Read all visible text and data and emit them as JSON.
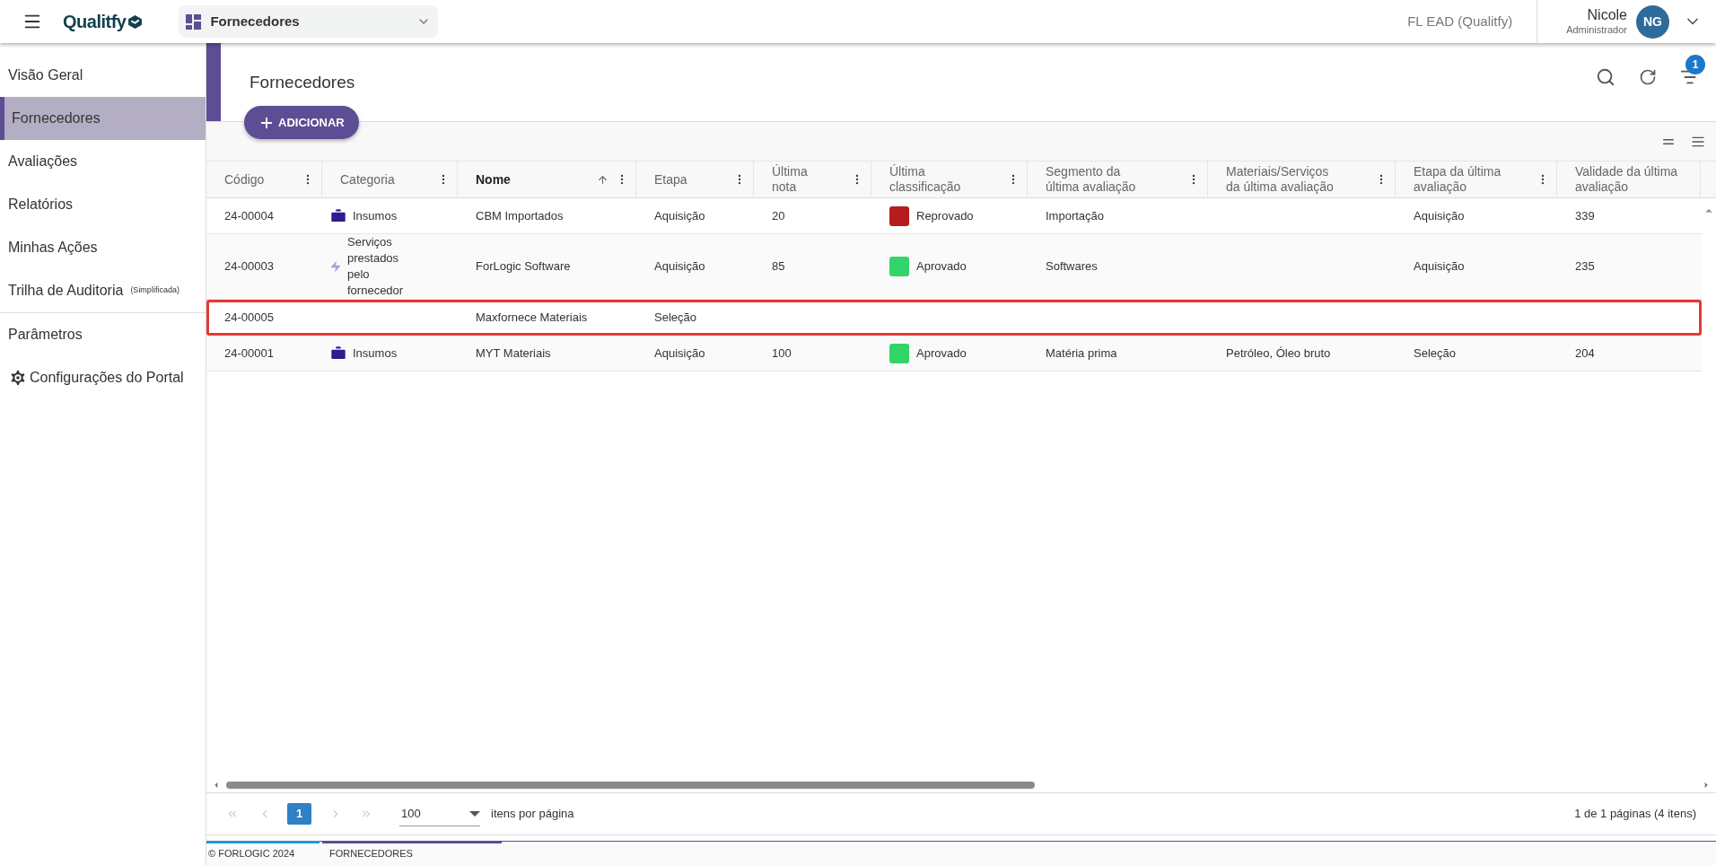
{
  "topbar": {
    "logo": "Qualitfy",
    "module": "Fornecedores",
    "org": "FL EAD (Qualitfy)",
    "user": {
      "name": "Nicole",
      "role": "Administrador",
      "initials": "NG"
    }
  },
  "sidebar": {
    "groups": [
      [
        {
          "label": "Visão Geral",
          "selected": false
        },
        {
          "label": "Fornecedores",
          "selected": true
        },
        {
          "label": "Avaliações",
          "selected": false
        },
        {
          "label": "Relatórios",
          "selected": false
        },
        {
          "label": "Minhas Ações",
          "selected": false
        },
        {
          "label": "Trilha de Auditoria",
          "note": "(Simplificada)",
          "selected": false
        }
      ],
      [
        {
          "label": "Parâmetros",
          "selected": false
        },
        {
          "label": "Configurações do Portal",
          "kind": "iconic",
          "selected": false
        }
      ]
    ]
  },
  "page": {
    "title": "Fornecedores",
    "add_button": "ADICIONAR",
    "filter_count": "1"
  },
  "table": {
    "columns": [
      {
        "label": "Código",
        "sorted": false,
        "menu": true
      },
      {
        "label": "Categoria",
        "sorted": false,
        "menu": true
      },
      {
        "label": "Nome",
        "sorted": true,
        "menu": true
      },
      {
        "label": "Etapa",
        "sorted": false,
        "menu": true
      },
      {
        "label": "Última nota",
        "sorted": false,
        "menu": true
      },
      {
        "label": "Última classificação",
        "sorted": false,
        "menu": true
      },
      {
        "label": "Segmento da última avaliação",
        "sorted": false,
        "menu": true
      },
      {
        "label": "Materiais/Serviços da última avaliação",
        "sorted": false,
        "menu": true
      },
      {
        "label": "Etapa da última avaliação",
        "sorted": false,
        "menu": true
      },
      {
        "label": "Validade da última avaliação",
        "sorted": false,
        "menu": false
      }
    ],
    "rows": [
      {
        "selected": false,
        "code": "24-00004",
        "category": {
          "kind": "briefcase",
          "label": "Insumos"
        },
        "name": "CBM Importados",
        "stage": "Aquisição",
        "grade": "20",
        "classification": {
          "label": "Reprovado",
          "color": "#b71c1c"
        },
        "segment": "Importação",
        "last_stage": "Aquisição",
        "validity": "339"
      },
      {
        "selected": false,
        "code": "24-00003",
        "category": {
          "kind": "bolt",
          "label": "Serviços prestados pelo fornecedor"
        },
        "name": "ForLogic Software",
        "stage": "Aquisição",
        "grade": "85",
        "classification": {
          "label": "Aprovado",
          "color": "#33d56a"
        },
        "segment": "Softwares",
        "last_stage": "Aquisição",
        "validity": "235"
      },
      {
        "selected": true,
        "code": "24-00005",
        "name": "Maxfornece Materiais",
        "stage": "Seleção"
      },
      {
        "selected": false,
        "code": "24-00001",
        "category": {
          "kind": "briefcase",
          "label": "Insumos"
        },
        "name": "MYT Materiais",
        "stage": "Aquisição",
        "grade": "100",
        "classification": {
          "label": "Aprovado",
          "color": "#33d56a"
        },
        "segment": "Matéria prima",
        "materials": "Petróleo, Óleo bruto",
        "last_stage": "Seleção",
        "validity": "204"
      }
    ]
  },
  "pagination": {
    "page": "1",
    "per_page": "100",
    "per_page_label": "itens por página",
    "summary": "1 de 1 páginas (4 itens)"
  },
  "footer": {
    "copyright": "© FORLOGIC 2024",
    "section": "FORNECEDORES"
  }
}
